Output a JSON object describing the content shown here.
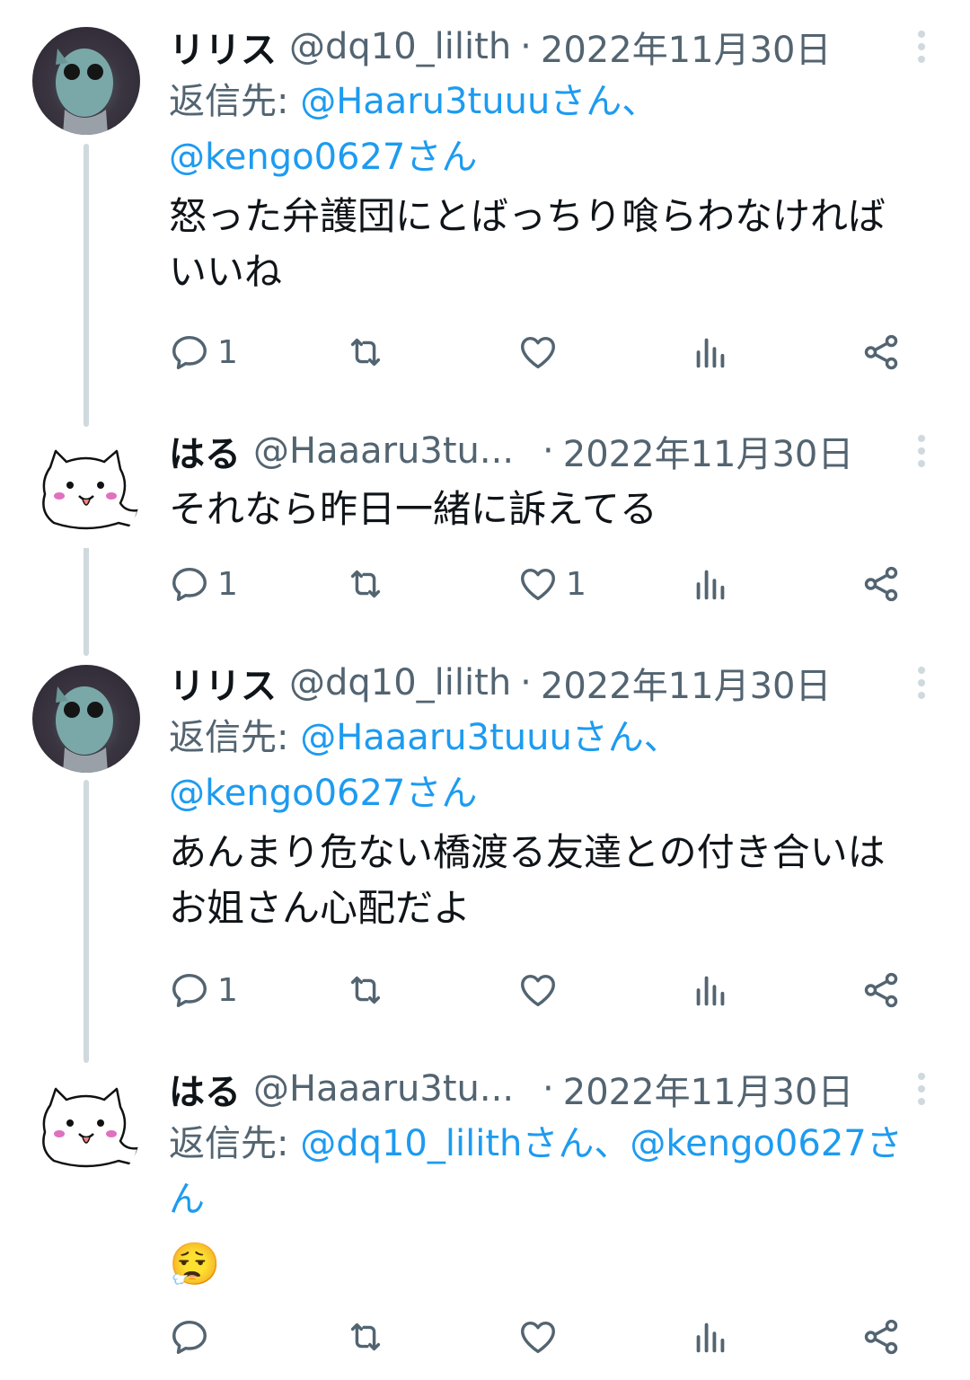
{
  "tweets": [
    {
      "name": "リリス",
      "handle": "@dq10_lilith",
      "sep": "·",
      "date": "2022年11月30日",
      "reply_prefix": "返信先:",
      "reply_mentions_line1": "@Haaru3tuuuさん、",
      "reply_mentions_line2": "@kengo0627さん",
      "text_line1": "怒った弁護団にとばっちり喰らわなければ",
      "text_line2": "いいね",
      "counts": {
        "reply": "1",
        "retweet": "",
        "like": "",
        "views": ""
      }
    },
    {
      "name": "はる",
      "handle": "@Haaaru3tu...",
      "sep": "·",
      "date": "2022年11月30日",
      "text_line1": "それなら昨日一緒に訴えてる",
      "counts": {
        "reply": "1",
        "retweet": "",
        "like": "1",
        "views": ""
      }
    },
    {
      "name": "リリス",
      "handle": "@dq10_lilith",
      "sep": "·",
      "date": "2022年11月30日",
      "reply_prefix": "返信先:",
      "reply_mentions_line1": "@Haaaru3tuuuさん、",
      "reply_mentions_line2": "@kengo0627さん",
      "text_line1": "あんまり危ない橋渡る友達との付き合いは",
      "text_line2": "お姐さん心配だよ",
      "counts": {
        "reply": "1",
        "retweet": "",
        "like": "",
        "views": ""
      }
    },
    {
      "name": "はる",
      "handle": "@Haaaru3tu...",
      "sep": "·",
      "date": "2022年11月30日",
      "reply_prefix": "返信先:",
      "reply_mentions_line1": "@dq10_lilithさん、@kengo0627さ",
      "reply_mentions_line2": "ん",
      "emoji": "😮‍💨",
      "counts": {
        "reply": "",
        "retweet": "",
        "like": "",
        "views": ""
      }
    }
  ],
  "icons": {
    "reply": "reply-icon",
    "retweet": "retweet-icon",
    "like": "heart-icon",
    "views": "views-icon",
    "share": "share-icon",
    "more": "more-icon"
  },
  "colors": {
    "text": "#0f1419",
    "secondary": "#536471",
    "link": "#1d9bf0",
    "thread_line": "#cfd9de"
  }
}
